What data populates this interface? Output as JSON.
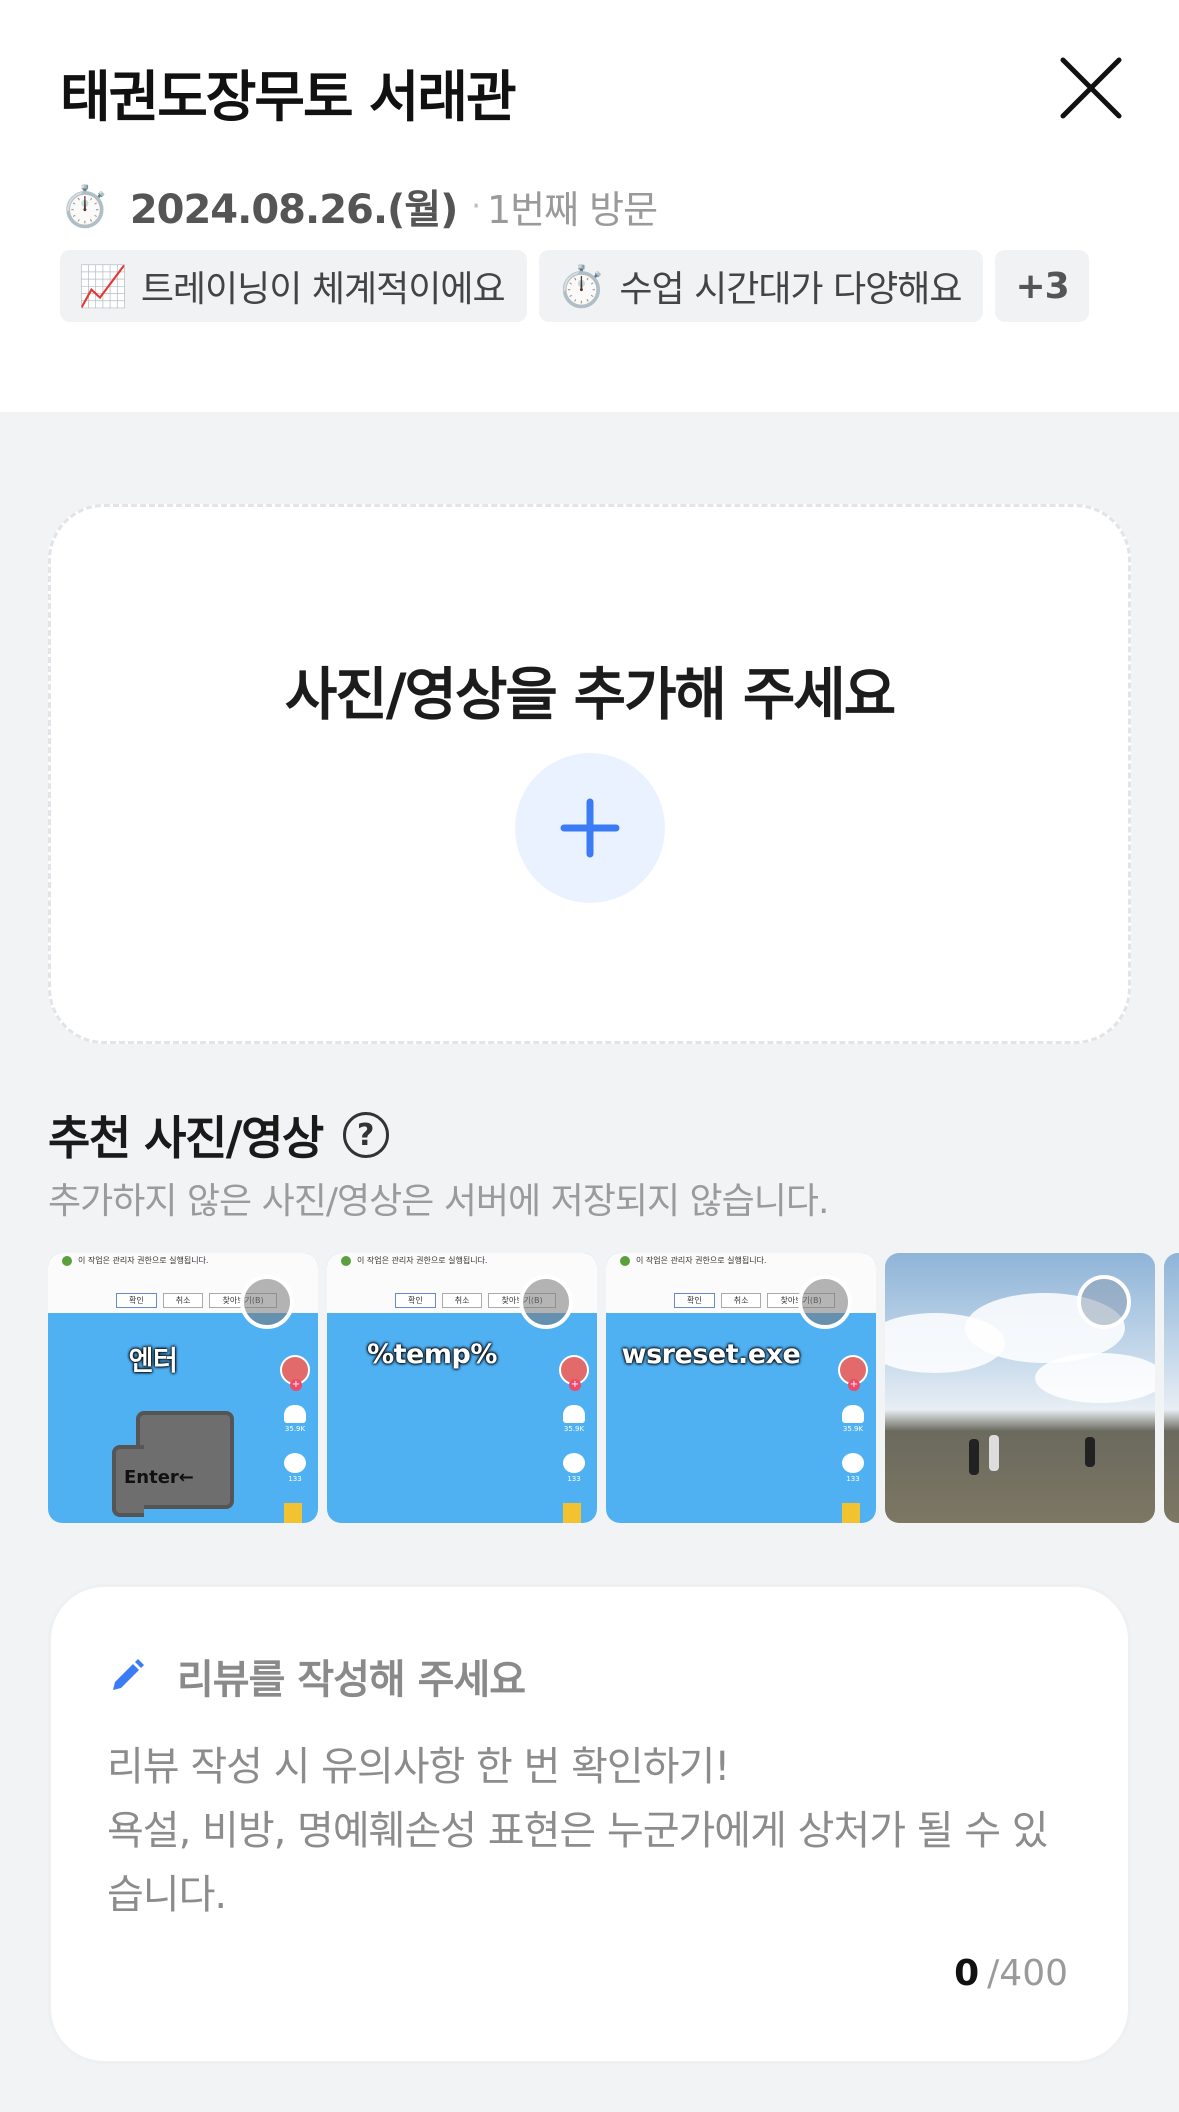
{
  "header": {
    "title": "태권도장무토 서래관",
    "visit_date": "2024.08.26.(월)",
    "visit_count": "1번째 방문",
    "chips": [
      {
        "emoji": "📈",
        "label": "트레이닝이 체계적이에요"
      },
      {
        "emoji": "⏱️",
        "label": "수업 시간대가 다양해요"
      }
    ],
    "more_chips": "+3"
  },
  "upload": {
    "title": "사진/영상을 추가해 주세요"
  },
  "recommend": {
    "title": "추천 사진/영상",
    "help": "?",
    "subtitle": "추가하지 않은 사진/영상은 서버에 저장되지 않습니다.",
    "thumbnails": [
      {
        "overlay": "엔터",
        "key_label": "Enter←",
        "dialog_note": "이 작업은 관리자 권한으로 실행됩니다.",
        "buttons": [
          "확인",
          "취소",
          "찾아보기(B)"
        ],
        "counts": [
          "35.9K",
          "133"
        ]
      },
      {
        "overlay": "%temp%",
        "dialog_note": "이 작업은 관리자 권한으로 실행됩니다.",
        "buttons": [
          "확인",
          "취소",
          "찾아보기(B)"
        ],
        "counts": [
          "35.9K",
          "133"
        ]
      },
      {
        "overlay": "wsreset.exe",
        "dialog_note": "이 작업은 관리자 권한으로 실행됩니다.",
        "buttons": [
          "확인",
          "취소",
          "찾아보기(B)"
        ],
        "counts": [
          "35.9K",
          "133"
        ]
      },
      {
        "type": "photo"
      }
    ]
  },
  "review": {
    "prompt": "리뷰를 작성해 주세요",
    "placeholder": "리뷰 작성 시 유의사항 한 번 확인하기!\n욕설, 비방, 명예훼손성 표현은 누군가에게 상처가 될 수 있습니다.",
    "count": "0",
    "max": "/400"
  },
  "colors": {
    "accent": "#3b7cf5",
    "plus_bg": "#eaf2ff",
    "background": "#f2f3f5"
  }
}
